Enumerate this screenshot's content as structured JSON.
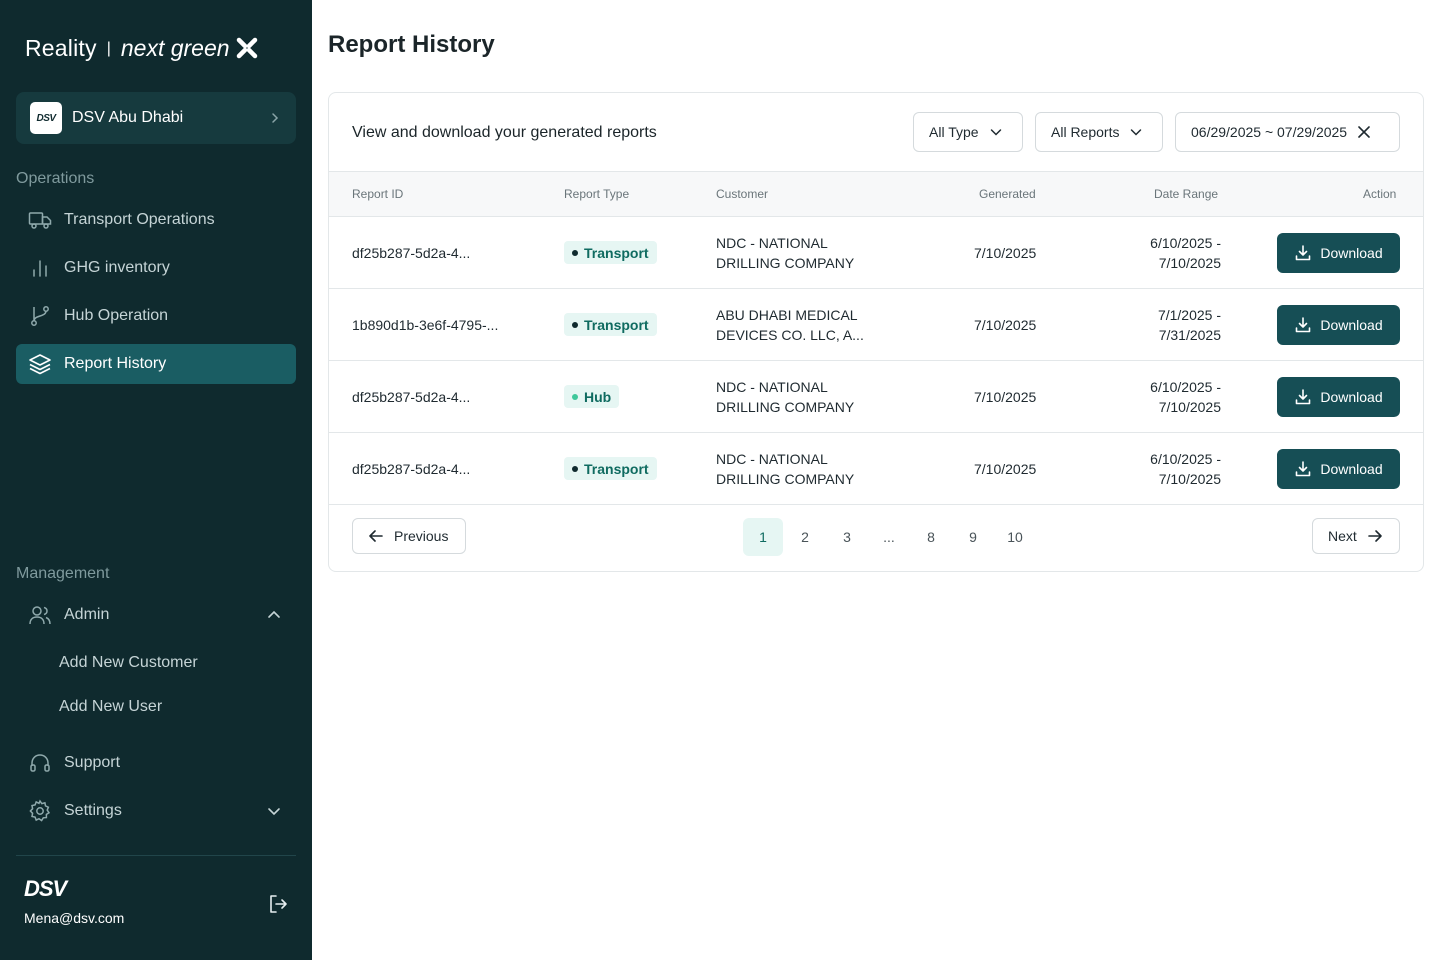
{
  "brand": {
    "name": "Reality",
    "separator": "|",
    "tagline": "next green"
  },
  "org": {
    "logo": "DSV",
    "name": "DSV Abu Dhabi"
  },
  "sections": {
    "operations": "Operations",
    "management": "Management"
  },
  "nav": {
    "transport": "Transport Operations",
    "ghg": "GHG inventory",
    "hub": "Hub Operation",
    "report_history": "Report History",
    "admin": "Admin",
    "add_customer": "Add New Customer",
    "add_user": "Add New User",
    "support": "Support",
    "settings": "Settings"
  },
  "footer": {
    "logo": "DSV",
    "email": "Mena@dsv.com"
  },
  "page": {
    "title": "Report History",
    "subtitle": "View and download your generated reports"
  },
  "filters": {
    "type": "All Type",
    "reports": "All Reports",
    "date_range": "06/29/2025 ~ 07/29/2025"
  },
  "table": {
    "headers": [
      "Report ID",
      "Report Type",
      "Customer",
      "Generated",
      "Date Range",
      "Action"
    ],
    "rows": [
      {
        "id": "df25b287-5d2a-4...",
        "type": "Transport",
        "customer_1": "NDC - NATIONAL",
        "customer_2": "DRILLING COMPANY",
        "generated": "7/10/2025",
        "range_1": "6/10/2025 -",
        "range_2": "7/10/2025",
        "action": "Download"
      },
      {
        "id": "1b890d1b-3e6f-4795-...",
        "type": "Transport",
        "customer_1": "ABU DHABI MEDICAL",
        "customer_2": "DEVICES CO. LLC, A...",
        "generated": "7/10/2025",
        "range_1": "7/1/2025 -",
        "range_2": "7/31/2025",
        "action": "Download"
      },
      {
        "id": "df25b287-5d2a-4...",
        "type": "Hub",
        "customer_1": "NDC - NATIONAL",
        "customer_2": "DRILLING COMPANY",
        "generated": "7/10/2025",
        "range_1": "6/10/2025 -",
        "range_2": "7/10/2025",
        "action": "Download"
      },
      {
        "id": "df25b287-5d2a-4...",
        "type": "Transport",
        "customer_1": "NDC - NATIONAL",
        "customer_2": "DRILLING COMPANY",
        "generated": "7/10/2025",
        "range_1": "6/10/2025 -",
        "range_2": "7/10/2025",
        "action": "Download"
      }
    ]
  },
  "pagination": {
    "previous": "Previous",
    "next": "Next",
    "pages": [
      "1",
      "2",
      "3",
      "...",
      "8",
      "9",
      "10"
    ],
    "current": "1"
  },
  "colors": {
    "sidebar_bg": "#0f2a2e",
    "active_nav": "#1a5d63",
    "button": "#164e55",
    "badge_bg": "#e6f6f3"
  }
}
